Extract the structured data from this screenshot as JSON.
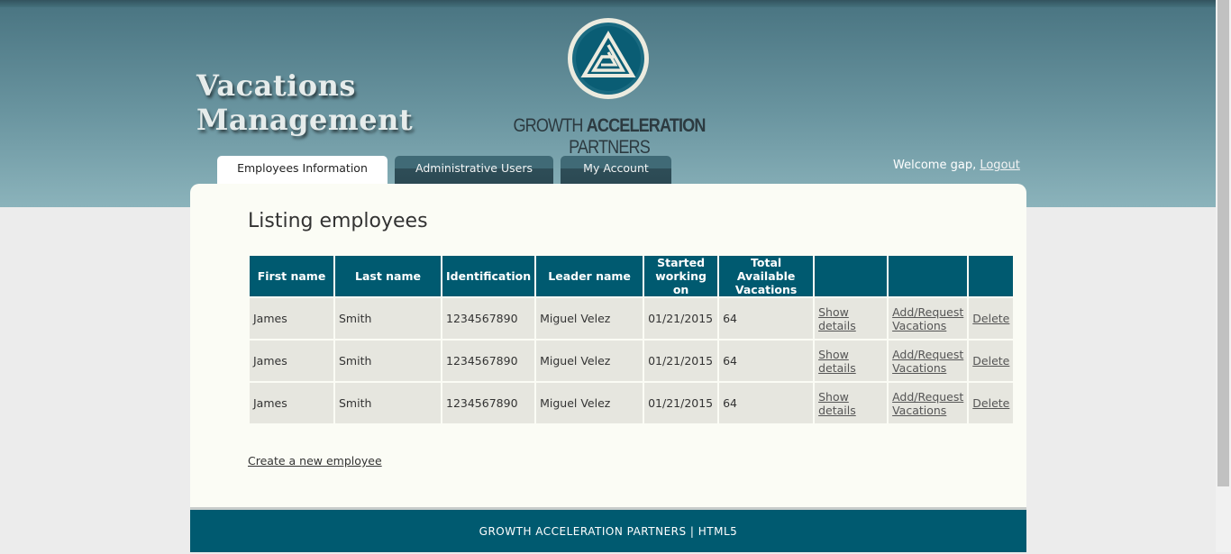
{
  "app": {
    "title_line1": "Vacations",
    "title_line2": "Management"
  },
  "brand": {
    "part1": "GROWTH ",
    "part2": "ACCELERATION",
    "part3": " PARTNERS",
    "logo_icon": "triangle-spiral-logo-icon"
  },
  "nav": {
    "tabs": [
      {
        "label": "Employees Information",
        "active": true
      },
      {
        "label": "Administrative Users",
        "active": false
      },
      {
        "label": "My Account",
        "active": false
      }
    ]
  },
  "user": {
    "welcome": "Welcome gap,",
    "logout": "Logout"
  },
  "main": {
    "title": "Listing employees",
    "columns": [
      "First name",
      "Last name",
      "Identification",
      "Leader name",
      "Started working on",
      "Total Available Vacations",
      "",
      "",
      ""
    ],
    "rows": [
      {
        "first": "James",
        "last": "Smith",
        "id": "1234567890",
        "leader": "Miguel Velez",
        "started": "01/21/2015",
        "vacations": "64",
        "show": "Show details",
        "add": "Add/Request Vacations",
        "delete": "Delete"
      },
      {
        "first": "James",
        "last": "Smith",
        "id": "1234567890",
        "leader": "Miguel Velez",
        "started": "01/21/2015",
        "vacations": "64",
        "show": "Show details",
        "add": "Add/Request Vacations",
        "delete": "Delete"
      },
      {
        "first": "James",
        "last": "Smith",
        "id": "1234567890",
        "leader": "Miguel Velez",
        "started": "01/21/2015",
        "vacations": "64",
        "show": "Show details",
        "add": "Add/Request Vacations",
        "delete": "Delete"
      }
    ],
    "create_link": "Create a new employee"
  },
  "footer": {
    "text": "GROWTH ACCELERATION PARTNERS | HTML5"
  },
  "colors": {
    "accent": "#005a70",
    "header_top": "#3f6572",
    "header_bottom": "#8bb3bb",
    "row_bg": "#e6e6df",
    "content_bg": "#fbfcf5"
  }
}
